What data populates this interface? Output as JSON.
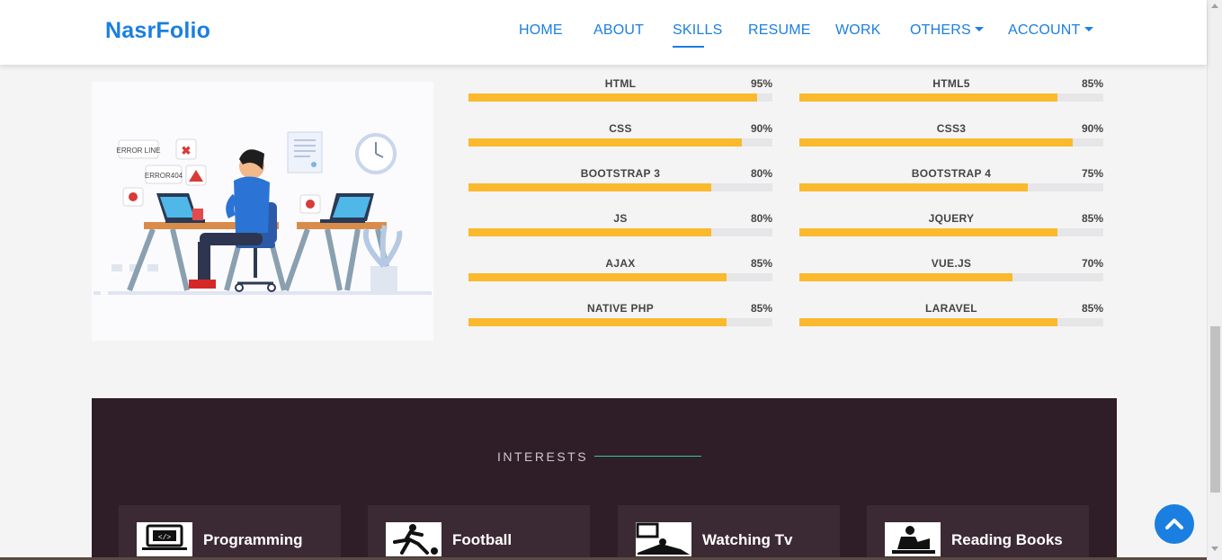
{
  "brand": "NasrFolio",
  "nav": [
    {
      "label": "HOME",
      "dropdown": false,
      "active": false
    },
    {
      "label": "ABOUT",
      "dropdown": false,
      "active": false
    },
    {
      "label": "SKILLS",
      "dropdown": false,
      "active": true
    },
    {
      "label": "RESUME",
      "dropdown": false,
      "active": false
    },
    {
      "label": "WORK",
      "dropdown": false,
      "active": false
    },
    {
      "label": "OTHERS",
      "dropdown": true,
      "active": false
    },
    {
      "label": "ACCOUNT",
      "dropdown": true,
      "active": false
    }
  ],
  "illustration": {
    "tag1": "ERROR LINE",
    "tag2": "ERROR404"
  },
  "skills_left": [
    {
      "name": "HTML",
      "percent_label": "95%",
      "level": 95
    },
    {
      "name": "CSS",
      "percent_label": "90%",
      "level": 90
    },
    {
      "name": "BOOTSTRAP 3",
      "percent_label": "80%",
      "level": 80
    },
    {
      "name": "JS",
      "percent_label": "80%",
      "level": 80
    },
    {
      "name": "AJAX",
      "percent_label": "85%",
      "level": 85
    },
    {
      "name": "NATIVE PHP",
      "percent_label": "85%",
      "level": 85
    }
  ],
  "skills_right": [
    {
      "name": "HTML5",
      "percent_label": "85%",
      "level": 85
    },
    {
      "name": "CSS3",
      "percent_label": "90%",
      "level": 90
    },
    {
      "name": "BOOTSTRAP 4",
      "percent_label": "75%",
      "level": 75
    },
    {
      "name": "JQUERY",
      "percent_label": "85%",
      "level": 85
    },
    {
      "name": "VUE.JS",
      "percent_label": "70%",
      "level": 70
    },
    {
      "name": "LARAVEL",
      "percent_label": "85%",
      "level": 85
    }
  ],
  "interests": {
    "title": "INTERESTS",
    "items": [
      {
        "label": "Programming",
        "icon": "monitor-code-icon"
      },
      {
        "label": "Football",
        "icon": "football-player-icon"
      },
      {
        "label": "Watching Tv",
        "icon": "tv-watching-icon"
      },
      {
        "label": "Reading Books",
        "icon": "reading-icon"
      }
    ]
  },
  "colors": {
    "brand": "#1a7fe0",
    "bar": "#fbb92e",
    "interests_bg": "#2f1d27",
    "accent_line": "#2ecc9a"
  }
}
